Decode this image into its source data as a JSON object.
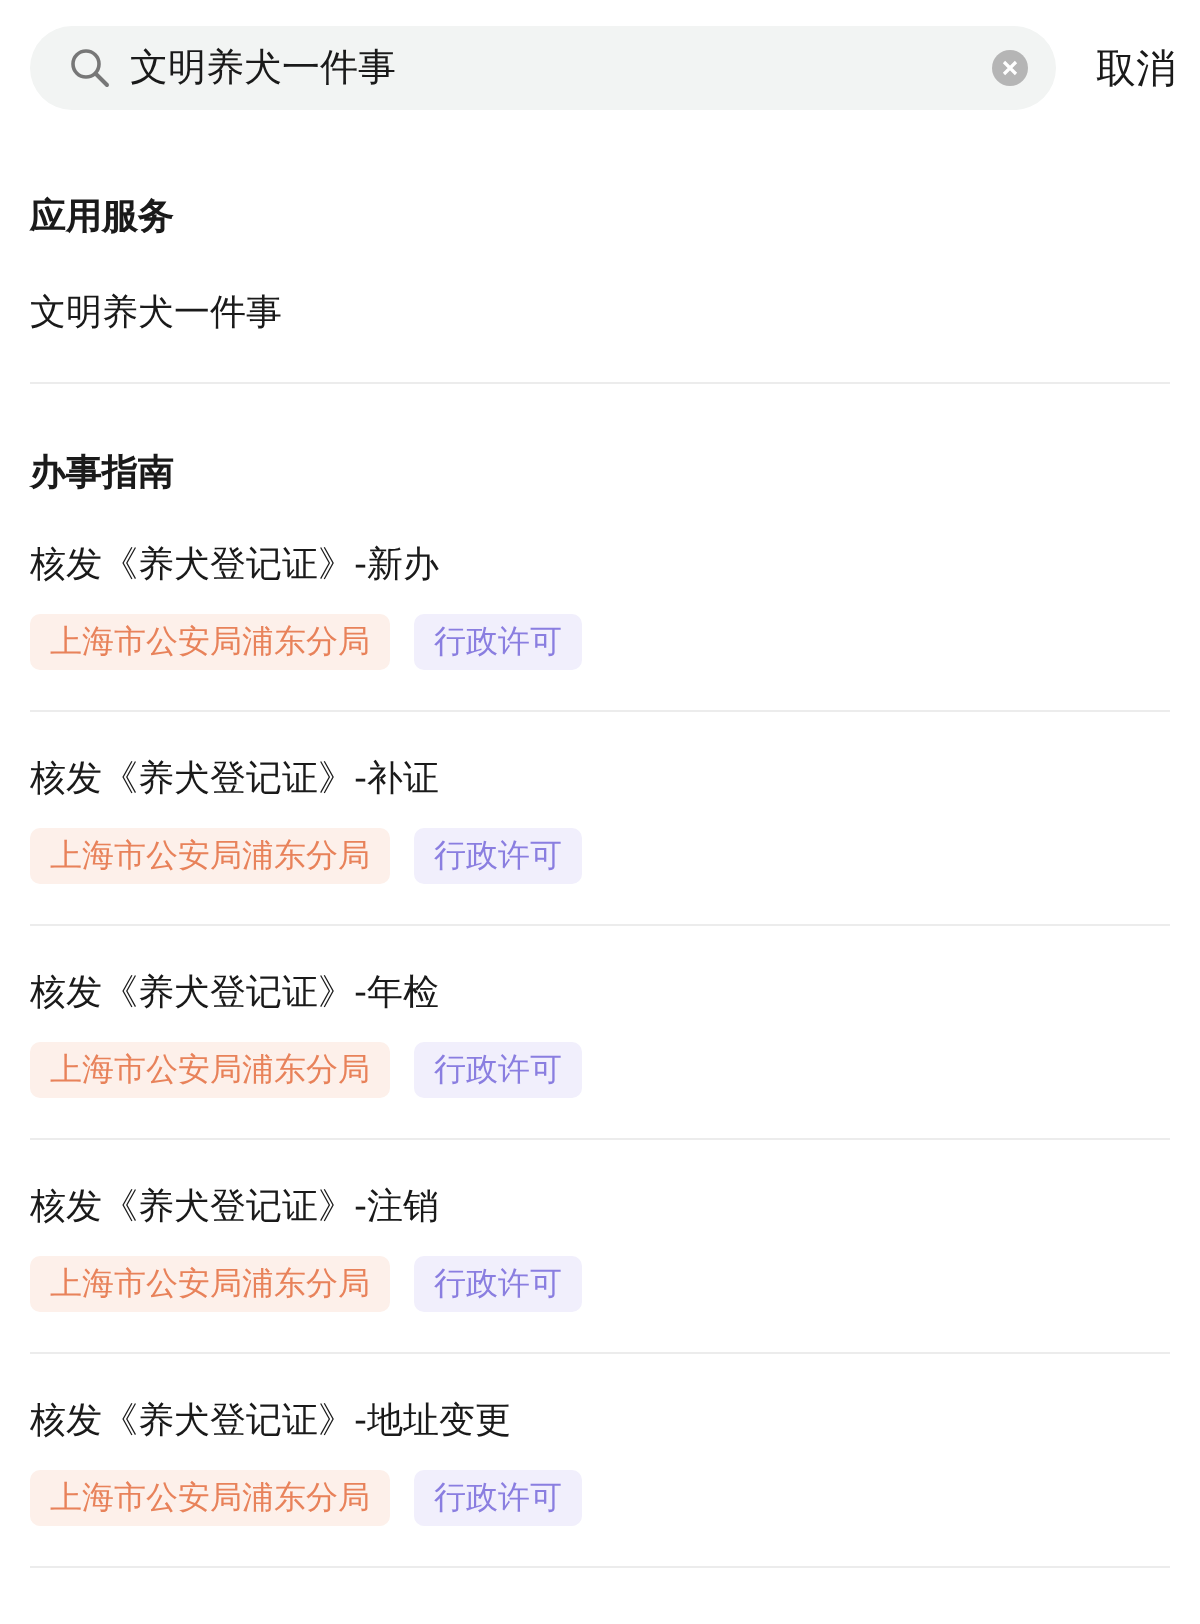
{
  "search": {
    "value": "文明养犬一件事",
    "cancel": "取消"
  },
  "sections": [
    {
      "title": "应用服务",
      "items": [
        {
          "title": "文明养犬一件事"
        }
      ]
    },
    {
      "title": "办事指南",
      "items": [
        {
          "title": "核发《养犬登记证》-新办",
          "tags": [
            {
              "kind": "department",
              "label": "上海市公安局浦东分局"
            },
            {
              "kind": "category",
              "label": "行政许可"
            }
          ]
        },
        {
          "title": "核发《养犬登记证》-补证",
          "tags": [
            {
              "kind": "department",
              "label": "上海市公安局浦东分局"
            },
            {
              "kind": "category",
              "label": "行政许可"
            }
          ]
        },
        {
          "title": "核发《养犬登记证》-年检",
          "tags": [
            {
              "kind": "department",
              "label": "上海市公安局浦东分局"
            },
            {
              "kind": "category",
              "label": "行政许可"
            }
          ]
        },
        {
          "title": "核发《养犬登记证》-注销",
          "tags": [
            {
              "kind": "department",
              "label": "上海市公安局浦东分局"
            },
            {
              "kind": "category",
              "label": "行政许可"
            }
          ]
        },
        {
          "title": "核发《养犬登记证》-地址变更",
          "tags": [
            {
              "kind": "department",
              "label": "上海市公安局浦东分局"
            },
            {
              "kind": "category",
              "label": "行政许可"
            }
          ]
        }
      ]
    }
  ]
}
